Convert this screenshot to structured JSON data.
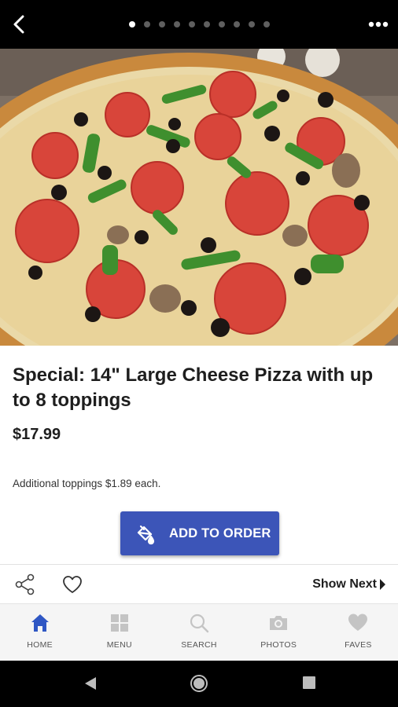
{
  "top_bar": {
    "back_icon": "chevron-left-icon",
    "more_icon": "more-horizontal-icon",
    "pagination": {
      "total": 10,
      "active_index": 0
    }
  },
  "product": {
    "title": "Special: 14\" Large Cheese Pizza with up to 8 toppings",
    "price": "$17.99",
    "note": "Additional toppings $1.89 each.",
    "add_button_label": "ADD TO ORDER",
    "add_button_icon": "paint-bucket-icon"
  },
  "action_bar": {
    "share_icon": "share-icon",
    "favorite_icon": "heart-outline-icon",
    "show_next_label": "Show Next"
  },
  "tabs": [
    {
      "label": "HOME",
      "icon": "home-icon",
      "active": true
    },
    {
      "label": "MENU",
      "icon": "grid-icon",
      "active": false
    },
    {
      "label": "SEARCH",
      "icon": "search-icon",
      "active": false
    },
    {
      "label": "PHOTOS",
      "icon": "camera-icon",
      "active": false
    },
    {
      "label": "FAVES",
      "icon": "heart-icon",
      "active": false
    }
  ],
  "colors": {
    "accent": "#3c55b8",
    "active_tab": "#2f57c4",
    "inactive_tab": "#c4c4c4"
  }
}
